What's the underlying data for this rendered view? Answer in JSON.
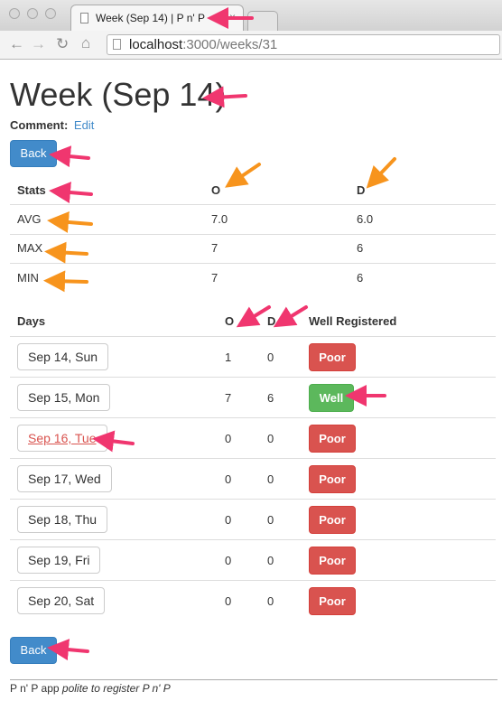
{
  "browser": {
    "tab_title": "Week (Sep 14) | P n' P",
    "tab_close": "×",
    "url_host": "localhost",
    "url_path": ":3000/weeks/31"
  },
  "page": {
    "title": "Week (Sep 14)",
    "comment_label": "Comment:",
    "comment_edit": "Edit",
    "back_label": "Back"
  },
  "stats": {
    "headers": [
      "Stats",
      "O",
      "D"
    ],
    "rows": [
      {
        "label": "AVG",
        "o": "7.0",
        "d": "6.0"
      },
      {
        "label": "MAX",
        "o": "7",
        "d": "6"
      },
      {
        "label": "MIN",
        "o": "7",
        "d": "6"
      }
    ]
  },
  "days": {
    "headers": [
      "Days",
      "O",
      "D",
      "Well Registered"
    ],
    "rows": [
      {
        "day": "Sep 14, Sun",
        "o": "1",
        "d": "0",
        "status": "Poor"
      },
      {
        "day": "Sep 15, Mon",
        "o": "7",
        "d": "6",
        "status": "Well"
      },
      {
        "day": "Sep 16, Tue",
        "o": "0",
        "d": "0",
        "status": "Poor"
      },
      {
        "day": "Sep 17, Wed",
        "o": "0",
        "d": "0",
        "status": "Poor"
      },
      {
        "day": "Sep 18, Thu",
        "o": "0",
        "d": "0",
        "status": "Poor"
      },
      {
        "day": "Sep 19, Fri",
        "o": "0",
        "d": "0",
        "status": "Poor"
      },
      {
        "day": "Sep 20, Sat",
        "o": "0",
        "d": "0",
        "status": "Poor"
      }
    ]
  },
  "footer": {
    "app": "P n' P app",
    "tagline": "polite to register P n' P"
  },
  "colors": {
    "primary": "#428bca",
    "danger": "#d9534f",
    "success": "#5cb85c",
    "annotation_pink": "#f0366f",
    "annotation_orange": "#f7941d"
  }
}
